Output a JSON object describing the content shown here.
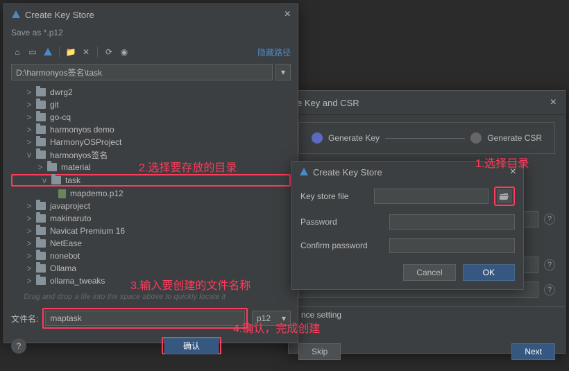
{
  "left": {
    "title": "Create Key Store",
    "save_as": "Save as *.p12",
    "hide_path": "隐藏路径",
    "path": "D:\\harmonyos签名\\task",
    "tree": [
      {
        "depth": 1,
        "chev": ">",
        "kind": "folder",
        "label": "dwrg2"
      },
      {
        "depth": 1,
        "chev": ">",
        "kind": "folder",
        "label": "git"
      },
      {
        "depth": 1,
        "chev": ">",
        "kind": "folder",
        "label": "go-cq"
      },
      {
        "depth": 1,
        "chev": ">",
        "kind": "folder",
        "label": "harmonyos demo"
      },
      {
        "depth": 1,
        "chev": ">",
        "kind": "folder",
        "label": "HarmonyOSProject"
      },
      {
        "depth": 1,
        "chev": "v",
        "kind": "folder",
        "label": "harmonyos签名"
      },
      {
        "depth": 2,
        "chev": ">",
        "kind": "folder",
        "label": "material"
      },
      {
        "depth": 2,
        "chev": "v",
        "kind": "folder",
        "label": "task",
        "selected": true
      },
      {
        "depth": 3,
        "chev": "",
        "kind": "file",
        "label": "mapdemo.p12"
      },
      {
        "depth": 1,
        "chev": ">",
        "kind": "folder",
        "label": "javaproject"
      },
      {
        "depth": 1,
        "chev": ">",
        "kind": "folder",
        "label": "makinaruto"
      },
      {
        "depth": 1,
        "chev": ">",
        "kind": "folder",
        "label": "Navicat Premium 16"
      },
      {
        "depth": 1,
        "chev": ">",
        "kind": "folder",
        "label": "NetEase"
      },
      {
        "depth": 1,
        "chev": ">",
        "kind": "folder",
        "label": "nonebot"
      },
      {
        "depth": 1,
        "chev": ">",
        "kind": "folder",
        "label": "Ollama"
      },
      {
        "depth": 1,
        "chev": ">",
        "kind": "folder",
        "label": "ollama_tweaks"
      }
    ],
    "hint": "Drag and drop a file into the space above to quickly locate it",
    "filename_label": "文件名:",
    "filename": "maptask",
    "ext": "p12",
    "confirm": "确认"
  },
  "right": {
    "title": "e Key and CSR",
    "step1": "Generate Key",
    "step2": "Generate CSR",
    "inner_title": "Create Key Store",
    "key_store_file": "Key store file",
    "password": "Password",
    "confirm_password": "Confirm password",
    "cancel": "Cancel",
    "ok": "OK",
    "nce_setting": "nce setting",
    "skip": "Skip",
    "next": "Next"
  },
  "ann": {
    "a1": "1.选择目录",
    "a2": "2.选择要存放的目录",
    "a3": "3.输入要创建的文件名称",
    "a4": "4.确认，完成创建"
  }
}
